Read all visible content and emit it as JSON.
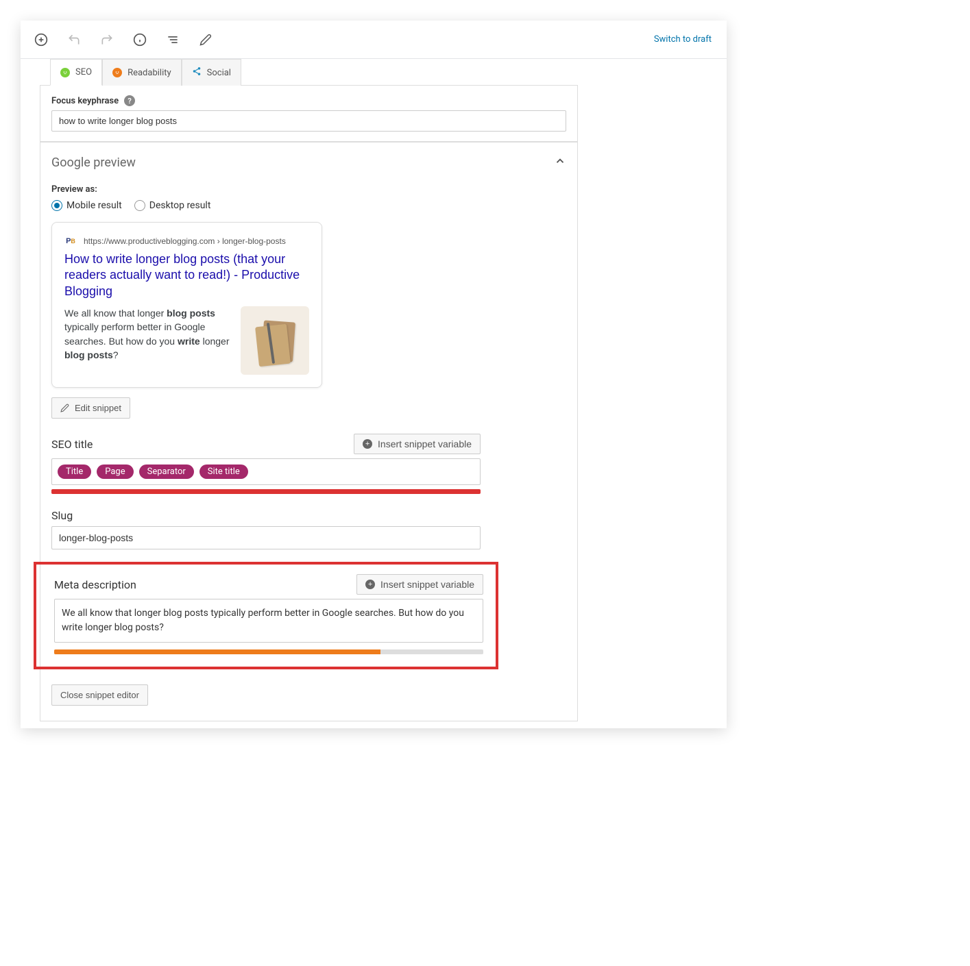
{
  "topbar": {
    "switch_to_draft": "Switch to draft"
  },
  "tabs": {
    "seo": "SEO",
    "readability": "Readability",
    "social": "Social"
  },
  "focus_keyphrase": {
    "label": "Focus keyphrase",
    "value": "how to write longer blog posts"
  },
  "google_preview": {
    "title": "Google preview",
    "preview_as_label": "Preview as:",
    "mobile_label": "Mobile result",
    "desktop_label": "Desktop result",
    "snippet_url": "https://www.productiveblogging.com › longer-blog-posts",
    "snippet_title": "How to write longer blog posts (that your readers actually want to read!) - Productive Blogging",
    "snippet_desc_pre": "We all know that longer ",
    "snippet_desc_bold1": "blog posts",
    "snippet_desc_mid1": " typically perform better in Google searches. But how do you ",
    "snippet_desc_bold2": "write",
    "snippet_desc_mid2": " longer ",
    "snippet_desc_bold3": "blog posts",
    "snippet_desc_end": "?",
    "edit_snippet": "Edit snippet"
  },
  "seo_title": {
    "label": "SEO title",
    "insert": "Insert snippet variable",
    "pills": [
      "Title",
      "Page",
      "Separator",
      "Site title"
    ]
  },
  "slug": {
    "label": "Slug",
    "value": "longer-blog-posts"
  },
  "meta": {
    "label": "Meta description",
    "insert": "Insert snippet variable",
    "value": "We all know that longer blog posts typically perform better in Google searches. But how do you write longer blog posts?"
  },
  "close_snippet": "Close snippet editor"
}
